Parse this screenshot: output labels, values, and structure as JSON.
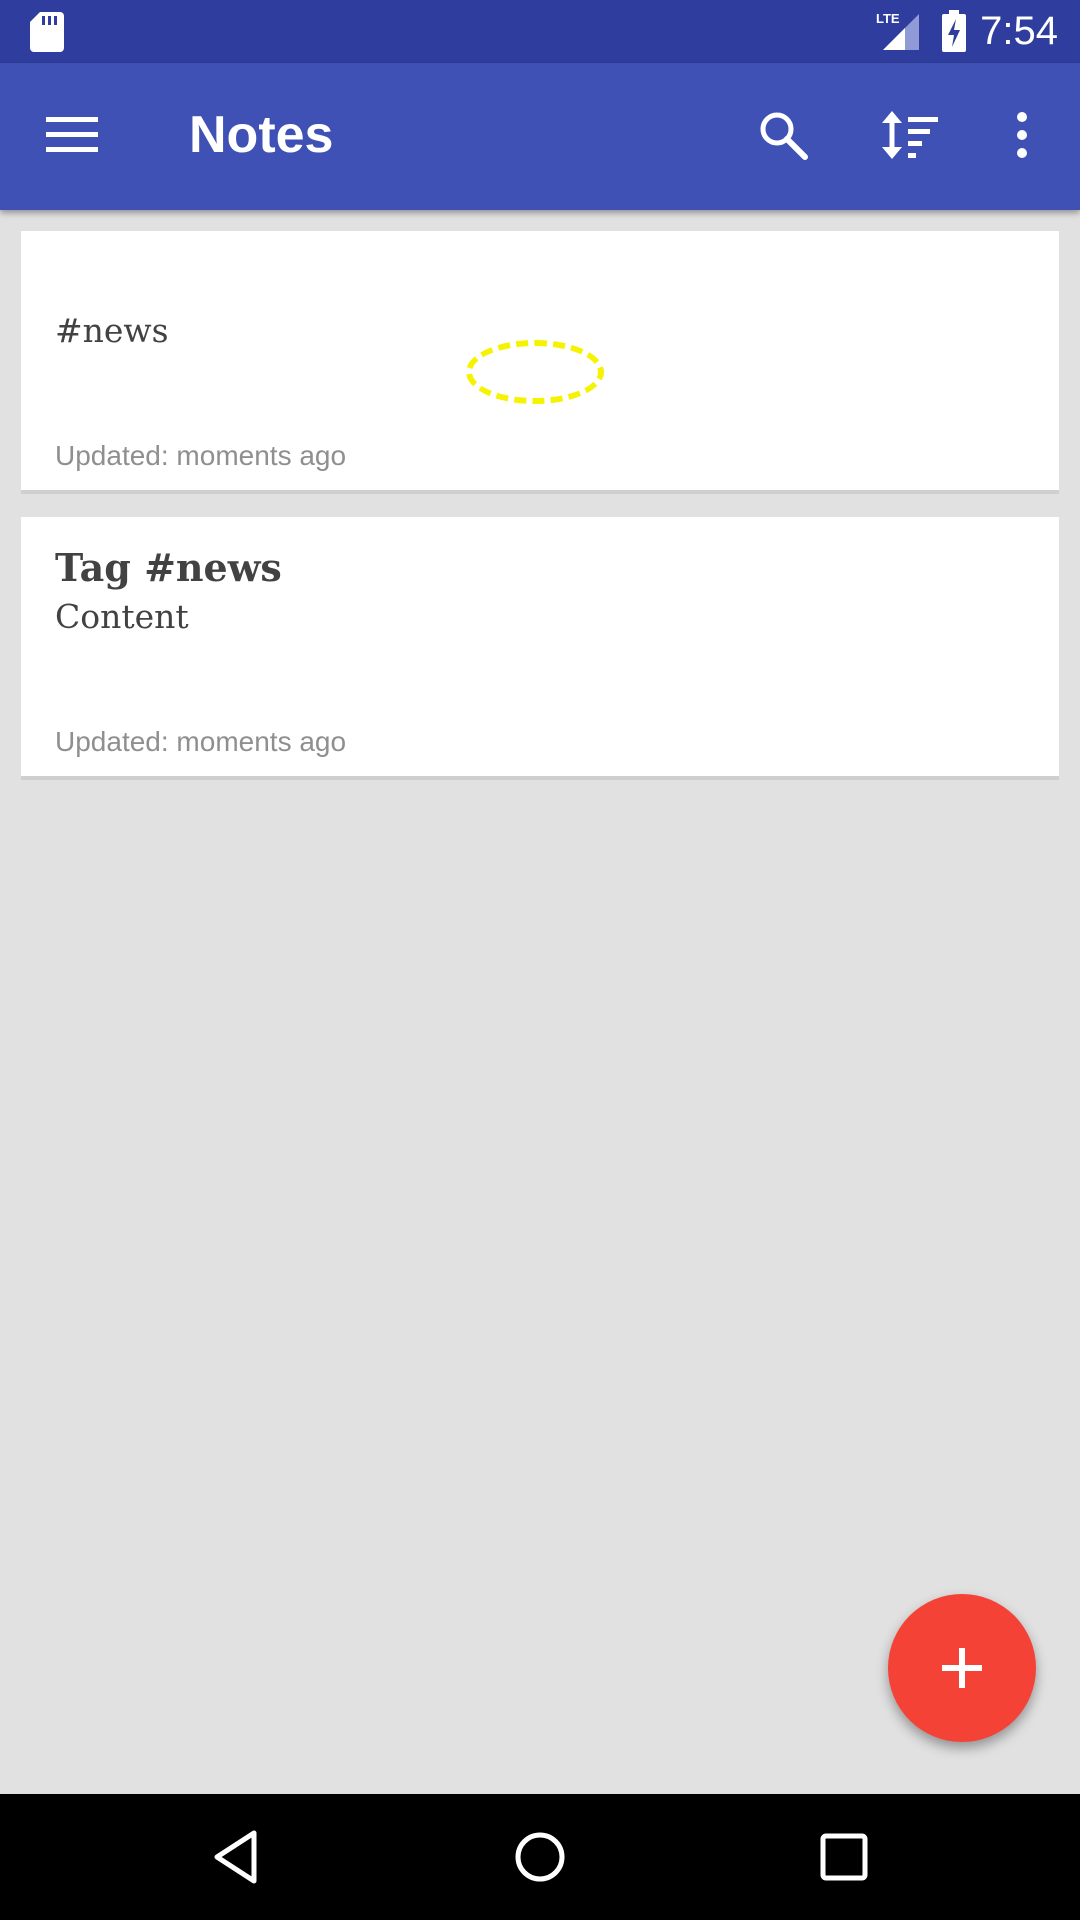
{
  "status_bar": {
    "time": "7:54",
    "icons": [
      "sd-card-icon",
      "lte-signal-icon",
      "battery-charging-icon"
    ]
  },
  "app_bar": {
    "title": "Notes",
    "actions": [
      "menu-icon",
      "search-icon",
      "sort-icon",
      "more-vert-icon"
    ]
  },
  "notes": [
    {
      "title": "",
      "body": "#news",
      "updated": "Updated: moments ago"
    },
    {
      "title": "Tag #news",
      "body": "Content",
      "updated": "Updated: moments ago"
    }
  ],
  "fab": {
    "icon": "add-icon"
  },
  "nav_bar": {
    "icons": [
      "back-icon",
      "home-icon",
      "recents-icon"
    ]
  },
  "colors": {
    "status_bar": "#2f3e9e",
    "app_bar": "#3f51b5",
    "background": "#e1e1e1",
    "fab": "#f44336",
    "touch_indicator": "#f5f300"
  }
}
